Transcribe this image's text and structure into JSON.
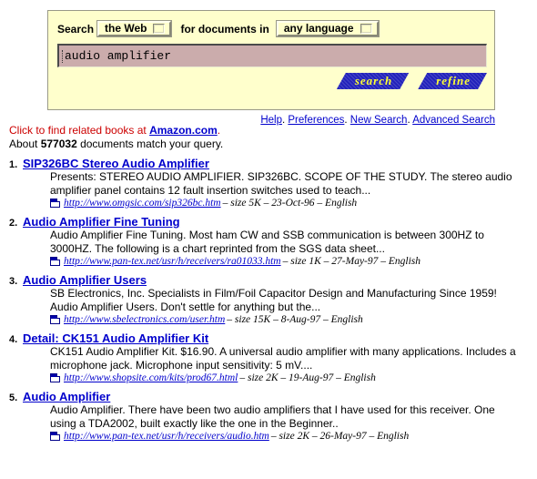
{
  "search_form": {
    "label_search": "Search",
    "scope_select": {
      "value": "the Web",
      "icon": "chevron-down-icon"
    },
    "label_for_documents_in": "for documents in",
    "language_select": {
      "value": "any language",
      "icon": "chevron-down-icon"
    },
    "query_input": {
      "value": "audio amplifier",
      "placeholder": ""
    },
    "buttons": [
      {
        "name": "search-button",
        "label": "search"
      },
      {
        "name": "refine-button",
        "label": "refine"
      }
    ]
  },
  "nav_links": {
    "separator": ".",
    "items": [
      "Help",
      "Preferences",
      "New Search",
      "Advanced Search"
    ]
  },
  "amazon_promo": {
    "prefix": "Click to find related books at ",
    "link": "Amazon.com",
    "suffix": "."
  },
  "result_count": {
    "prefix": "About ",
    "count": "577032",
    "suffix": " documents match your query."
  },
  "results": [
    {
      "rank": "1.",
      "title": "SIP326BC Stereo Audio Amplifier",
      "snippet": "Presents: STEREO AUDIO AMPLIFIER. SIP326BC. SCOPE OF THE STUDY. The stereo audio amplifier panel contains 12 fault insertion switches used to teach...",
      "url": "http://www.omgsic.com/sip326bc.htm",
      "meta": "– size 5K – 23-Oct-96 – English",
      "icon": "document-icon"
    },
    {
      "rank": "2.",
      "title": "Audio Amplifier Fine Tuning",
      "snippet": "Audio Amplifier Fine Tuning. Most ham CW and SSB communication is between 300HZ to 3000HZ. The following is a chart reprinted from the SGS data sheet...",
      "url": "http://www.pan-tex.net/usr/h/receivers/ra01033.htm",
      "meta": "– size 1K – 27-May-97 – English",
      "icon": "document-icon"
    },
    {
      "rank": "3.",
      "title": "Audio Amplifier Users",
      "snippet": "SB Electronics, Inc. Specialists in Film/Foil Capacitor Design and Manufacturing Since 1959! Audio Amplifier Users. Don't settle for anything but the...",
      "url": "http://www.sbelectronics.com/user.htm",
      "meta": "– size 15K – 8-Aug-97 – English",
      "icon": "document-icon"
    },
    {
      "rank": "4.",
      "title": "Detail: CK151 Audio Amplifier Kit",
      "snippet": "CK151 Audio Amplifier Kit. $16.90. A universal audio amplifier with many applications. Includes a microphone jack. Microphone input sensitivity: 5 mV....",
      "url": "http://www.shopsite.com/kits/prod67.html",
      "meta": "– size 2K – 19-Aug-97 – English",
      "icon": "document-icon"
    },
    {
      "rank": "5.",
      "title": "Audio Amplifier",
      "snippet": "Audio Amplifier. There have been two audio amplifiers that I have used for this receiver. One using a TDA2002, built exactly like the one in the Beginner..",
      "url": "http://www.pan-tex.net/usr/h/receivers/audio.htm",
      "meta": "– size 2K – 26-May-97 – English",
      "icon": "document-icon"
    }
  ],
  "colors": {
    "panel_background": "#ffffcc",
    "input_background": "#cbacac",
    "link": "#0000cc",
    "promo_text": "#cc0000",
    "button_background": "#2222bb",
    "button_text": "#ffff33"
  }
}
